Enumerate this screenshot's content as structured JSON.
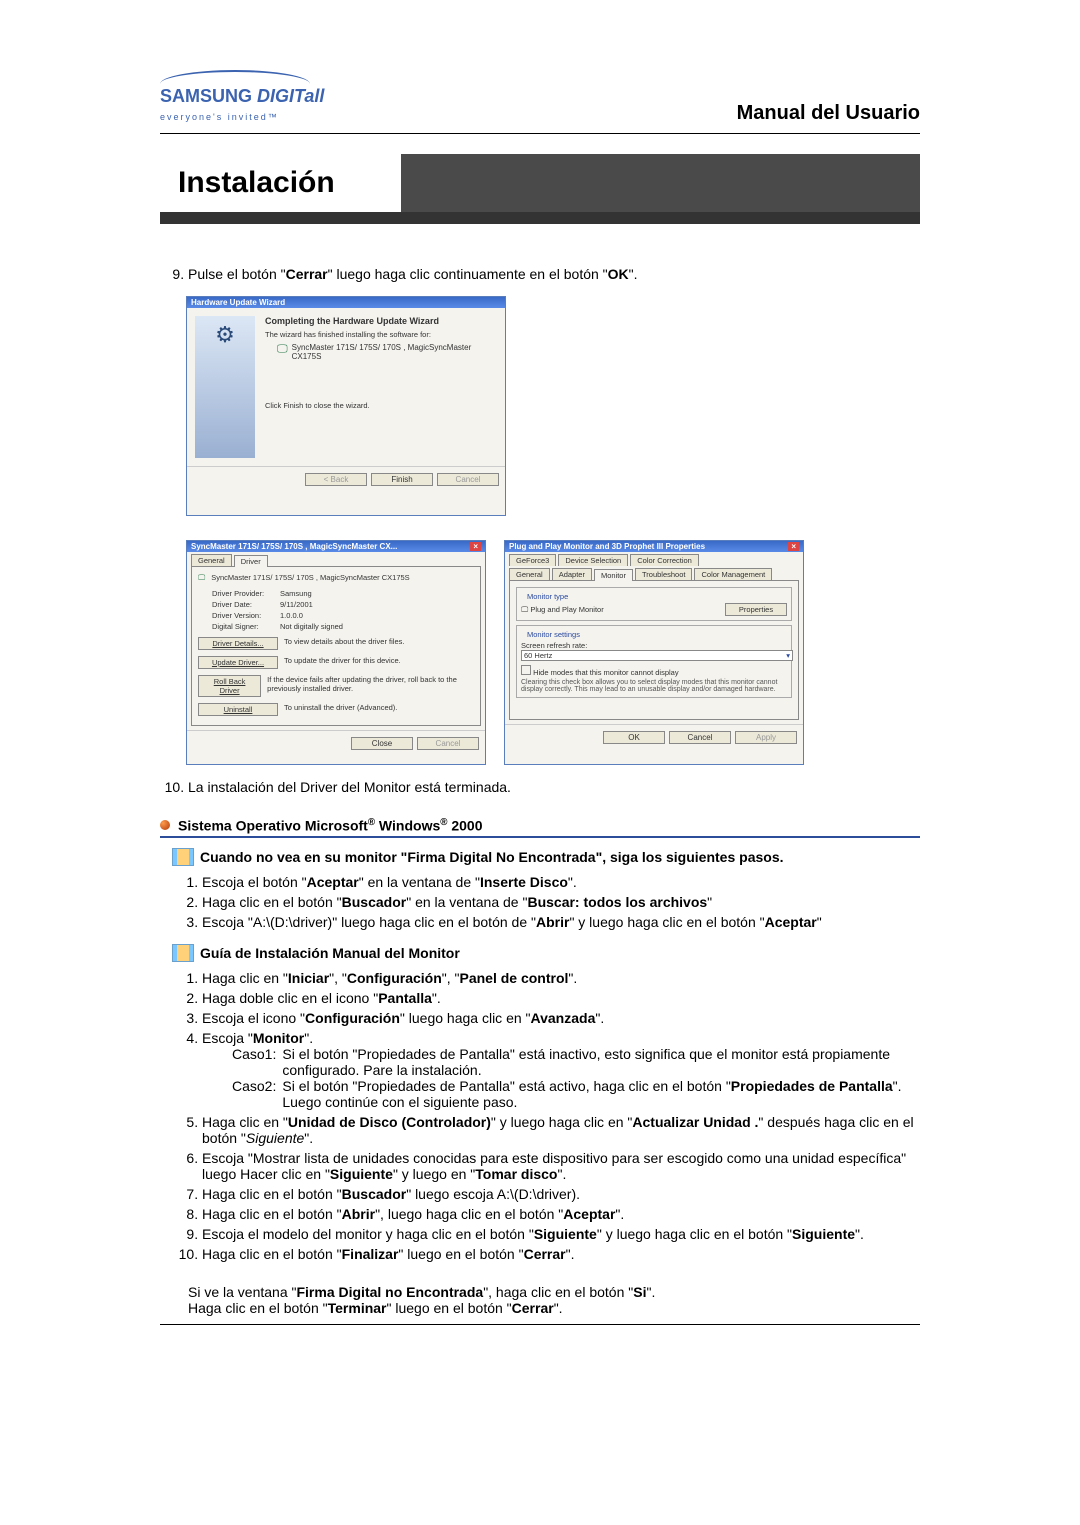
{
  "logo": {
    "brand1": "SAMSUNG ",
    "brand2": "DIGITall",
    "tagline": "everyone's invited™"
  },
  "doc_title": "Manual del Usuario",
  "section_title": "Instalación",
  "step9": {
    "number": "9.",
    "pre": "Pulse el botón \"",
    "b1": "Cerrar",
    "mid": "\" luego haga clic continuamente en el botón \"",
    "b2": "OK",
    "post": "\"."
  },
  "wizard": {
    "title": "Hardware Update Wizard",
    "heading": "Completing the Hardware Update Wizard",
    "line1": "The wizard has finished installing the software for:",
    "device": "SyncMaster 171S/ 175S/ 170S , MagicSyncMaster CX175S",
    "finish_hint": "Click Finish to close the wizard.",
    "btn_back": "< Back",
    "btn_finish": "Finish",
    "btn_cancel": "Cancel"
  },
  "props1": {
    "title": "SyncMaster 171S/ 175S/ 170S , MagicSyncMaster CX...",
    "tab_general": "General",
    "tab_driver": "Driver",
    "device": "SyncMaster 171S/ 175S/ 170S , MagicSyncMaster CX175S",
    "rows": [
      {
        "l": "Driver Provider:",
        "v": "Samsung"
      },
      {
        "l": "Driver Date:",
        "v": "9/11/2001"
      },
      {
        "l": "Driver Version:",
        "v": "1.0.0.0"
      },
      {
        "l": "Digital Signer:",
        "v": "Not digitally signed"
      }
    ],
    "btns": [
      {
        "l": "Driver Details...",
        "d": "To view details about the driver files."
      },
      {
        "l": "Update Driver...",
        "d": "To update the driver for this device."
      },
      {
        "l": "Roll Back Driver",
        "d": "If the device fails after updating the driver, roll back to the previously installed driver."
      },
      {
        "l": "Uninstall",
        "d": "To uninstall the driver (Advanced)."
      }
    ],
    "close": "Close",
    "cancel": "Cancel"
  },
  "props2": {
    "title": "Plug and Play Monitor and 3D Prophet III Properties",
    "tabs_top": [
      "GeForce3",
      "Device Selection",
      "Color Correction"
    ],
    "tabs_bot": [
      "General",
      "Adapter",
      "Monitor",
      "Troubleshoot",
      "Color Management"
    ],
    "monitor_type": "Monitor type",
    "pnp": "Plug and Play Monitor",
    "properties": "Properties",
    "monitor_settings": "Monitor settings",
    "refresh": "Screen refresh rate:",
    "refresh_val": "60 Hertz",
    "hide": "Hide modes that this monitor cannot display",
    "hide_desc": "Clearing this check box allows you to select display modes that this monitor cannot display correctly. This may lead to an unusable display and/or damaged hardware.",
    "ok": "OK",
    "cancel": "Cancel",
    "apply": "Apply"
  },
  "step10": "La instalación del Driver del Monitor está terminada.",
  "os_header": {
    "pre": "Sistema Operativo Microsoft",
    "reg1": "®",
    "mid": " Windows",
    "reg2": "®",
    "post": " 2000"
  },
  "sub_firma": "Cuando no vea en su monitor \"Firma Digital No Encontrada\", siga los siguientes pasos.",
  "firma_steps": [
    {
      "pre": "Escoja el botón \"",
      "b1": "Aceptar",
      "mid": "\" en la ventana de \"",
      "b2": "Inserte Disco",
      "post": "\"."
    },
    {
      "pre": "Haga clic en el botón \"",
      "b1": "Buscador",
      "mid": "\" en la ventana de \"",
      "b2": "Buscar: todos los archivos",
      "post": "\""
    },
    {
      "pre": "Escoja \"A:\\(D:\\driver)\" luego haga clic en el botón de \"",
      "b1": "Abrir",
      "mid": "\" y luego haga clic en el botón \"",
      "b2": "Aceptar",
      "post": "\""
    }
  ],
  "sub_guia": "Guía de Instalación Manual del Monitor",
  "guia": {
    "s1": {
      "pre": "Haga clic en \"",
      "b1": "Iniciar",
      "m1": "\", \"",
      "b2": "Configuración",
      "m2": "\", \"",
      "b3": "Panel de control",
      "post": "\"."
    },
    "s2": {
      "pre": "Haga doble clic en el icono \"",
      "b1": "Pantalla",
      "post": "\"."
    },
    "s3": {
      "pre": "Escoja el icono \"",
      "b1": "Configuración",
      "mid": "\" luego haga clic en \"",
      "b2": "Avanzada",
      "post": "\"."
    },
    "s4": {
      "pre": "Escoja \"",
      "b1": "Monitor",
      "post": "\"."
    },
    "caso1_l": "Caso1:",
    "caso1_t": "Si el botón \"Propiedades de Pantalla\" está inactivo, esto significa que el monitor está propiamente configurado. Pare la instalación.",
    "caso2_l": "Caso2:",
    "caso2_t_pre": "Si el botón \"Propiedades de Pantalla\" está activo, haga clic en el botón \"",
    "caso2_b": "Propiedades de Pantalla",
    "caso2_t_post": "\". Luego continúe con el siguiente paso.",
    "s5": {
      "pre": "Haga clic en \"",
      "b1": "Unidad de Disco (Controlador)",
      "mid": "\" y luego haga clic en \"",
      "b2": "Actualizar Unidad .",
      "post": "\" después haga clic en el botón \"",
      "ipost": "Siguiente",
      "tail": "\"."
    },
    "s6": {
      "pre": "Escoja \"Mostrar lista de unidades conocidas para este dispositivo para ser escogido como una unidad específica\" luego Hacer clic en \"",
      "b1": "Siguiente",
      "mid": "\" y luego en \"",
      "b2": "Tomar disco",
      "post": "\"."
    },
    "s7": {
      "pre": "Haga clic en el botón \"",
      "b1": "Buscador",
      "post": "\" luego escoja A:\\(D:\\driver)."
    },
    "s8": {
      "pre": "Haga clic en el botón \"",
      "b1": "Abrir",
      "mid": "\", luego haga clic en el botón \"",
      "b2": "Aceptar",
      "post": "\"."
    },
    "s9": {
      "pre": "Escoja el modelo del monitor y haga clic en el botón \"",
      "b1": "Siguiente",
      "mid": "\" y luego haga clic en el botón \"",
      "b2": "Siguiente",
      "post": "\"."
    },
    "s10": {
      "pre": "Haga clic en el botón \"",
      "b1": "Finalizar",
      "mid": "\" luego en el botón \"",
      "b2": "Cerrar",
      "post": "\"."
    }
  },
  "bottom_note": {
    "l1_pre": "Si ve la ventana \"",
    "l1_b": "Firma Digital no Encontrada",
    "l1_mid": "\", haga clic en el botón \"",
    "l1_b2": "Si",
    "l1_post": "\".",
    "l2_pre": "Haga clic en el botón \"",
    "l2_b": "Terminar",
    "l2_mid": "\" luego en el botón \"",
    "l2_b2": "Cerrar",
    "l2_post": "\"."
  }
}
